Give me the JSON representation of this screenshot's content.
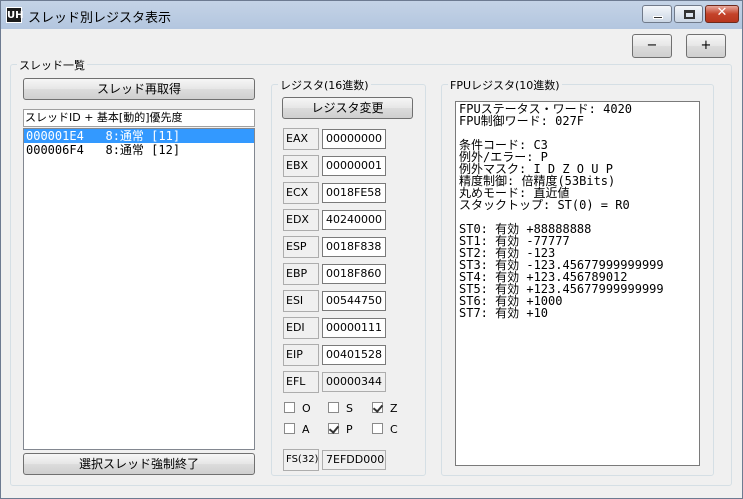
{
  "window": {
    "title": "スレッド別レジスタ表示",
    "icon_text": "UH",
    "icons": {
      "minimize": "minimize-icon",
      "maximize": "maximize-icon",
      "close": "close-icon"
    }
  },
  "toolbar": {
    "minus_label": "−",
    "plus_label": "+"
  },
  "thread_group": {
    "label": "スレッド一覧",
    "refresh_button": "スレッド再取得",
    "list_header": "スレッドID + 基本[動的]優先度",
    "threads": [
      {
        "text": "000001E4   8:通常 [11]",
        "selected": true
      },
      {
        "text": "000006F4   8:通常 [12]",
        "selected": false
      }
    ],
    "terminate_button": "選択スレッド強制終了"
  },
  "register_group": {
    "label": "レジスタ(16進数)",
    "change_button": "レジスタ変更",
    "registers": [
      {
        "name": "EAX",
        "value": "00000000",
        "readonly": false
      },
      {
        "name": "EBX",
        "value": "00000001",
        "readonly": false
      },
      {
        "name": "ECX",
        "value": "0018FE58",
        "readonly": false
      },
      {
        "name": "EDX",
        "value": "40240000",
        "readonly": false
      },
      {
        "name": "ESP",
        "value": "0018F838",
        "readonly": false
      },
      {
        "name": "EBP",
        "value": "0018F860",
        "readonly": false
      },
      {
        "name": "ESI",
        "value": "00544750",
        "readonly": false
      },
      {
        "name": "EDI",
        "value": "00000111",
        "readonly": false
      },
      {
        "name": "EIP",
        "value": "00401528",
        "readonly": false
      },
      {
        "name": "EFL",
        "value": "00000344",
        "readonly": true
      }
    ],
    "flags": [
      {
        "name": "O",
        "checked": false
      },
      {
        "name": "S",
        "checked": false
      },
      {
        "name": "Z",
        "checked": true
      },
      {
        "name": "A",
        "checked": false
      },
      {
        "name": "P",
        "checked": true
      },
      {
        "name": "C",
        "checked": false
      }
    ],
    "fs": {
      "name": "FS(32)",
      "value": "7EFDD000"
    }
  },
  "fpu_group": {
    "label": "FPUレジスタ(10進数)",
    "lines": [
      "FPUステータス・ワード: 4020",
      "FPU制御ワード: 027F",
      "",
      "条件コード: C3",
      "例外/エラー: P",
      "例外マスク: I D Z O U P",
      "精度制御: 倍精度(53Bits)",
      "丸めモード: 直近値",
      "スタックトップ: ST(0) = R0",
      "",
      "ST0: 有効 +88888888",
      "ST1: 有効 -77777",
      "ST2: 有効 -123",
      "ST3: 有効 -123.45677999999999",
      "ST4: 有効 +123.456789012",
      "ST5: 有効 +123.45677999999999",
      "ST6: 有効 +1000",
      "ST7: 有効 +10"
    ]
  }
}
